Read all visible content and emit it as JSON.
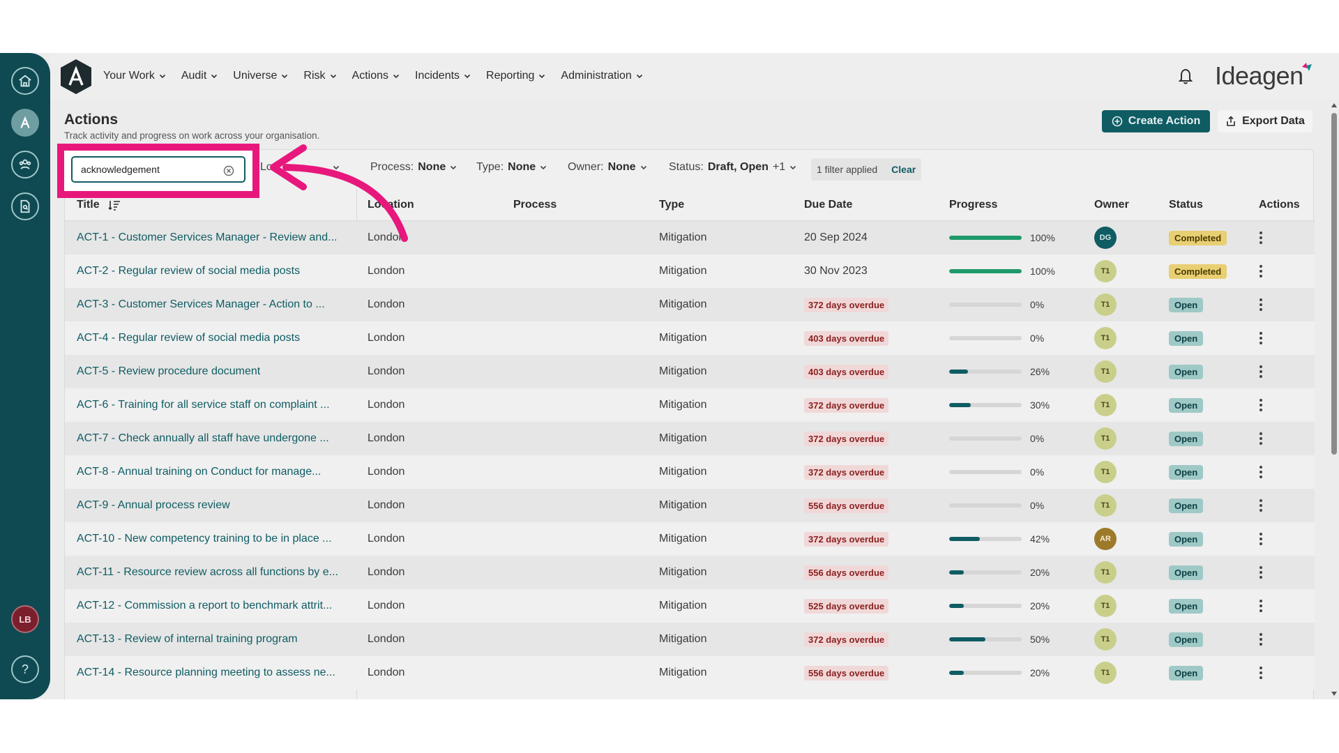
{
  "nav": {
    "items": [
      "Your Work",
      "Audit",
      "Universe",
      "Risk",
      "Actions",
      "Incidents",
      "Reporting",
      "Administration"
    ],
    "brand": "Ideagen"
  },
  "rail": {
    "avatar_initials": "LB",
    "help_symbol": "?"
  },
  "page": {
    "title": "Actions",
    "subtitle": "Track activity and progress on work across your organisation.",
    "create_label": "Create Action",
    "export_label": "Export Data"
  },
  "search": {
    "value": "acknowledgement"
  },
  "filters": {
    "location": {
      "label": "Lo",
      "value": ""
    },
    "process": {
      "label": "Process:",
      "value": "None"
    },
    "type": {
      "label": "Type:",
      "value": "None"
    },
    "owner": {
      "label": "Owner:",
      "value": "None"
    },
    "status": {
      "label": "Status:",
      "value": "Draft, Open",
      "extra": "+1"
    },
    "applied": "1 filter applied",
    "clear": "Clear"
  },
  "table": {
    "headers": {
      "title": "Title",
      "location": "Location",
      "process": "Process",
      "type": "Type",
      "due": "Due Date",
      "progress": "Progress",
      "owner": "Owner",
      "status": "Status",
      "actions": "Actions"
    },
    "rows": [
      {
        "title": "ACT-1 - Customer Services Manager - Review and...",
        "location": "London",
        "type": "Mitigation",
        "due": "20 Sep 2024",
        "overdue": false,
        "progress": 100,
        "progress_label": "100%",
        "owner": "DG",
        "status": "Completed"
      },
      {
        "title": "ACT-2 - Regular review of social media posts",
        "location": "London",
        "type": "Mitigation",
        "due": "30 Nov 2023",
        "overdue": false,
        "progress": 100,
        "progress_label": "100%",
        "owner": "T1",
        "status": "Completed"
      },
      {
        "title": "ACT-3 - Customer Services Manager - Action to ...",
        "location": "London",
        "type": "Mitigation",
        "due": "372 days overdue",
        "overdue": true,
        "progress": 0,
        "progress_label": "0%",
        "owner": "T1",
        "status": "Open"
      },
      {
        "title": "ACT-4 - Regular review of social media posts",
        "location": "London",
        "type": "Mitigation",
        "due": "403 days overdue",
        "overdue": true,
        "progress": 0,
        "progress_label": "0%",
        "owner": "T1",
        "status": "Open"
      },
      {
        "title": "ACT-5 - Review procedure document",
        "location": "London",
        "type": "Mitigation",
        "due": "403 days overdue",
        "overdue": true,
        "progress": 26,
        "progress_label": "26%",
        "owner": "T1",
        "status": "Open"
      },
      {
        "title": "ACT-6 - Training for all service staff on complaint ...",
        "location": "London",
        "type": "Mitigation",
        "due": "372 days overdue",
        "overdue": true,
        "progress": 30,
        "progress_label": "30%",
        "owner": "T1",
        "status": "Open"
      },
      {
        "title": "ACT-7 - Check annually all staff have undergone ...",
        "location": "London",
        "type": "Mitigation",
        "due": "372 days overdue",
        "overdue": true,
        "progress": 0,
        "progress_label": "0%",
        "owner": "T1",
        "status": "Open"
      },
      {
        "title": "ACT-8 - Annual training on Conduct for manage...",
        "location": "London",
        "type": "Mitigation",
        "due": "372 days overdue",
        "overdue": true,
        "progress": 0,
        "progress_label": "0%",
        "owner": "T1",
        "status": "Open"
      },
      {
        "title": "ACT-9 - Annual process review",
        "location": "London",
        "type": "Mitigation",
        "due": "556 days overdue",
        "overdue": true,
        "progress": 0,
        "progress_label": "0%",
        "owner": "T1",
        "status": "Open"
      },
      {
        "title": "ACT-10 - New competency training to be in place ...",
        "location": "London",
        "type": "Mitigation",
        "due": "372 days overdue",
        "overdue": true,
        "progress": 42,
        "progress_label": "42%",
        "owner": "AR",
        "status": "Open"
      },
      {
        "title": "ACT-11 - Resource review across all functions by e...",
        "location": "London",
        "type": "Mitigation",
        "due": "556 days overdue",
        "overdue": true,
        "progress": 20,
        "progress_label": "20%",
        "owner": "T1",
        "status": "Open"
      },
      {
        "title": "ACT-12 - Commission a report to benchmark attrit...",
        "location": "London",
        "type": "Mitigation",
        "due": "525 days overdue",
        "overdue": true,
        "progress": 20,
        "progress_label": "20%",
        "owner": "T1",
        "status": "Open"
      },
      {
        "title": "ACT-13 - Review of internal training program",
        "location": "London",
        "type": "Mitigation",
        "due": "372 days overdue",
        "overdue": true,
        "progress": 50,
        "progress_label": "50%",
        "owner": "T1",
        "status": "Open"
      },
      {
        "title": "ACT-14 - Resource planning meeting to assess ne...",
        "location": "London",
        "type": "Mitigation",
        "due": "556 days overdue",
        "overdue": true,
        "progress": 20,
        "progress_label": "20%",
        "owner": "T1",
        "status": "Open"
      }
    ]
  },
  "colors": {
    "accent": "#0f5c63",
    "highlight": "#e8177c",
    "progress_complete": "#1f9a6b",
    "progress_partial": "#0f5c63",
    "completed_badge_bg": "#e9cf74",
    "completed_badge_text": "#4a3a00",
    "open_badge_bg": "#9fc9c6",
    "open_badge_text": "#0c3e43"
  }
}
